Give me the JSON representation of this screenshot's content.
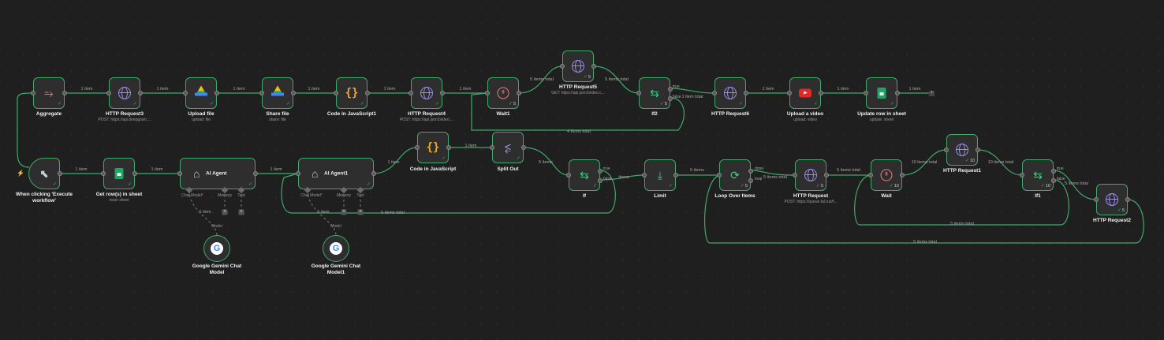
{
  "nodes": {
    "aggregate": {
      "title": "Aggregate",
      "sub": "",
      "icon": "aggregate-icon"
    },
    "http3": {
      "title": "HTTP Request3",
      "sub": "POST: https://api.deepgram....",
      "icon": "globe-icon"
    },
    "upload_file": {
      "title": "Upload file",
      "sub": "upload: file",
      "icon": "google-drive-icon"
    },
    "share_file": {
      "title": "Share file",
      "sub": "share: file",
      "icon": "google-drive-icon"
    },
    "code_js1": {
      "title": "Code in JavaScript1",
      "sub": "",
      "icon": "code-braces-icon"
    },
    "http4": {
      "title": "HTTP Request4",
      "sub": "POST: https://api.json2video....",
      "icon": "globe-icon"
    },
    "wait1": {
      "title": "Wait1",
      "sub": "",
      "icon": "pause-icon",
      "count": "5"
    },
    "http5": {
      "title": "HTTP Request5",
      "sub": "GET: https://api.json2video.c...",
      "icon": "globe-icon",
      "count": "5"
    },
    "if2": {
      "title": "If2",
      "sub": "",
      "icon": "signpost-icon",
      "count": "5"
    },
    "http6": {
      "title": "HTTP Request6",
      "sub": "",
      "icon": "globe-icon"
    },
    "upload_video": {
      "title": "Upload a video",
      "sub": "upload: video",
      "icon": "youtube-icon"
    },
    "update_row": {
      "title": "Update row in sheet",
      "sub": "update: sheet",
      "icon": "google-sheets-icon"
    },
    "trigger": {
      "title": "When clicking 'Execute workflow'",
      "sub": "",
      "icon": "cursor-icon"
    },
    "get_rows": {
      "title": "Get row(s) in sheet",
      "sub": "read: sheet",
      "icon": "google-sheets-icon"
    },
    "ai_agent": {
      "title": "AI Agent",
      "icon": "robot-icon"
    },
    "ai_agent1": {
      "title": "AI Agent1",
      "icon": "robot-icon"
    },
    "code_js": {
      "title": "Code in JavaScript",
      "sub": "",
      "icon": "code-braces-icon"
    },
    "split_out": {
      "title": "Split Out",
      "sub": "",
      "icon": "split-icon"
    },
    "if": {
      "title": "If",
      "sub": "",
      "icon": "signpost-icon"
    },
    "limit": {
      "title": "Limit",
      "sub": "",
      "icon": "limit-icon"
    },
    "loop": {
      "title": "Loop Over Items",
      "sub": "",
      "icon": "loop-icon",
      "count": "5"
    },
    "http": {
      "title": "HTTP Request",
      "sub": "POST: https://queue.fal.run/f...",
      "icon": "globe-icon",
      "count": "5"
    },
    "wait": {
      "title": "Wait",
      "sub": "",
      "icon": "pause-icon",
      "count": "10"
    },
    "http1": {
      "title": "HTTP Request1",
      "sub": "",
      "icon": "globe-icon",
      "count": "10"
    },
    "if1": {
      "title": "If1",
      "sub": "",
      "icon": "signpost-icon",
      "count": "10"
    },
    "http2": {
      "title": "HTTP Request2",
      "sub": "",
      "icon": "globe-icon",
      "count": "5"
    },
    "gemini": {
      "title": "Google Gemini Chat Model",
      "icon": "google-gemini-icon"
    },
    "gemini1": {
      "title": "Google Gemini Chat Model1",
      "icon": "google-gemini-icon"
    }
  },
  "agent_ports": {
    "chat_model": "Chat Model",
    "required": "*",
    "memory": "Memory",
    "tool": "Tool",
    "model": "Model"
  },
  "branches": {
    "true": "true",
    "false": "false",
    "done": "done",
    "loop": "loop"
  },
  "conn": {
    "one_item": "1 item",
    "five_items_total": "5 items total",
    "five_items": "5 items",
    "four_items_total": "4 items total",
    "ten_items_total": "10 items total",
    "items": "items",
    "one_item_total": "1 item total"
  },
  "wait_glyph": "II",
  "plus_glyph": "+",
  "check_glyph": "✓",
  "colors": {
    "canvas": "#1f1f1f",
    "wire": "#3fa96b",
    "node_bg": "#2e2e2e",
    "http": "#9a8cf0",
    "code": "#f5a623",
    "wait": "#ef7d8a"
  }
}
